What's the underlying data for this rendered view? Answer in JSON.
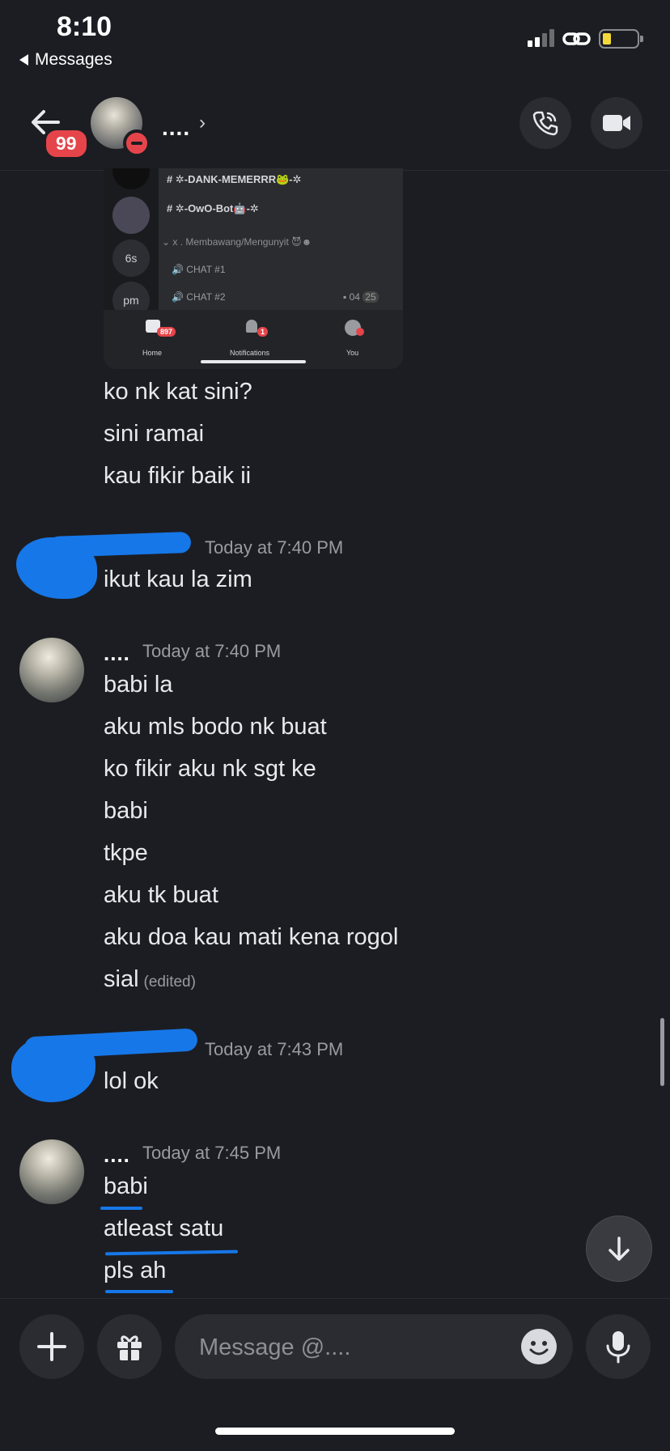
{
  "status_bar": {
    "time": "8:10",
    "back_app": "Messages"
  },
  "header": {
    "unread_badge": "99",
    "contact_name": "....",
    "chevron": "›"
  },
  "embed": {
    "channels": [
      {
        "name": "# ✲-DANK-MEMERRR🐸-✲"
      },
      {
        "name": "# ✲-OwO-Bot🤖-✲"
      }
    ],
    "category": "⌄ x . Membawang/Mengunyit 😈☻",
    "voice_channels": [
      {
        "name": "CHAT #1"
      },
      {
        "name": "CHAT #2",
        "extra": "04",
        "extra2": "25"
      }
    ],
    "server_labels": [
      "6s",
      "pm"
    ],
    "tabs": [
      {
        "label": "Home",
        "badge": "897"
      },
      {
        "label": "Notifications",
        "badge": "1"
      },
      {
        "label": "You"
      }
    ]
  },
  "messages": {
    "group1": [
      "ko nk kat sini?",
      "sini ramai",
      "kau fikir baik ii"
    ],
    "group2": {
      "time": "Today at 7:40 PM",
      "lines": [
        "ikut kau la zim"
      ]
    },
    "group3": {
      "author": "....",
      "time": "Today at 7:40 PM",
      "lines": [
        "babi la",
        "aku mls bodo nk buat",
        "ko fikir aku nk sgt ke",
        "babi",
        "tkpe",
        "aku tk buat",
        "aku doa kau mati kena rogol",
        "sial"
      ],
      "edited": "(edited)"
    },
    "group4": {
      "time": "Today at 7:43 PM",
      "lines": [
        "lol ok"
      ]
    },
    "group5": {
      "author": "....",
      "time": "Today at 7:45 PM",
      "lines": [
        "babi",
        "atleast satu",
        "pls ah"
      ]
    }
  },
  "composer": {
    "placeholder": "Message @...."
  },
  "colors": {
    "background": "#1c1d22",
    "accent_red": "#e5454a",
    "scribble_blue": "#1677e8"
  }
}
